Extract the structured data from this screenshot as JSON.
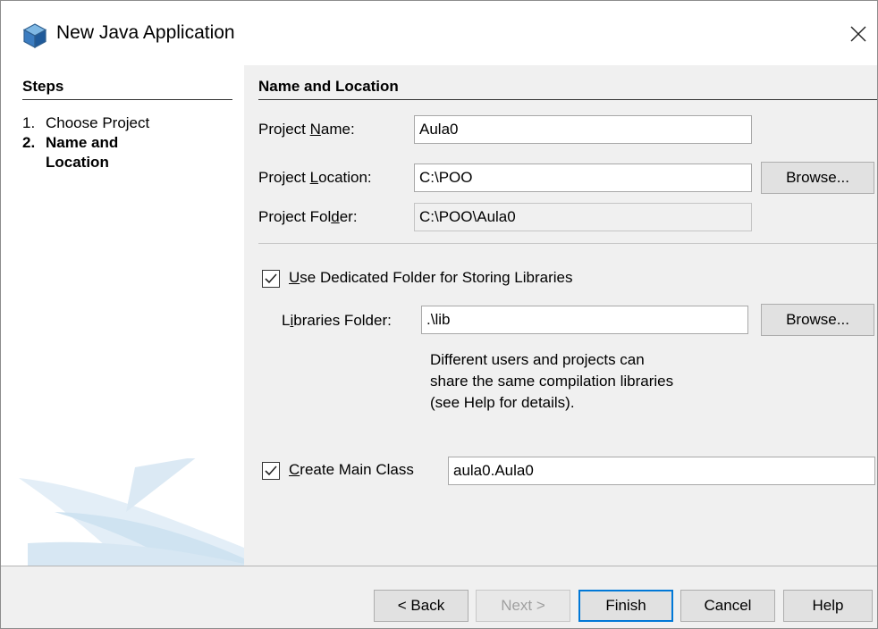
{
  "window": {
    "title": "New Java Application",
    "icon": "netbeans-cube-icon",
    "close_icon": "close-icon"
  },
  "steps": {
    "title": "Steps",
    "items": [
      {
        "num": "1.",
        "label": "Choose Project",
        "current": false
      },
      {
        "num": "2.",
        "label": "Name and Location",
        "current": true
      }
    ]
  },
  "form": {
    "section_title": "Name and Location",
    "project_name": {
      "label": "Project Name:",
      "mnemonic": "N",
      "value": "Aula0"
    },
    "project_location": {
      "label": "Project Location:",
      "mnemonic": "L",
      "value": "C:\\POO",
      "browse_label": "Browse..."
    },
    "project_folder": {
      "label": "Project Folder:",
      "mnemonic": "d",
      "value": "C:\\POO\\Aula0"
    },
    "dedicated_folder": {
      "label": "Use Dedicated Folder for Storing Libraries",
      "mnemonic": "U",
      "checked": true
    },
    "libraries_folder": {
      "label": "Libraries Folder:",
      "mnemonic": "i",
      "value": ".\\lib",
      "browse_label": "Browse..."
    },
    "libraries_help": [
      "Different users and projects can",
      "share the same compilation libraries",
      "(see Help for details)."
    ],
    "main_class": {
      "label": "Create Main Class",
      "mnemonic": "C",
      "checked": true,
      "value": "aula0.Aula0"
    }
  },
  "buttons": {
    "back": "< Back",
    "next": "Next >",
    "finish": "Finish",
    "cancel": "Cancel",
    "help": "Help"
  },
  "colors": {
    "accent": "#0078d7",
    "swoosh": "#cfe3f1"
  }
}
